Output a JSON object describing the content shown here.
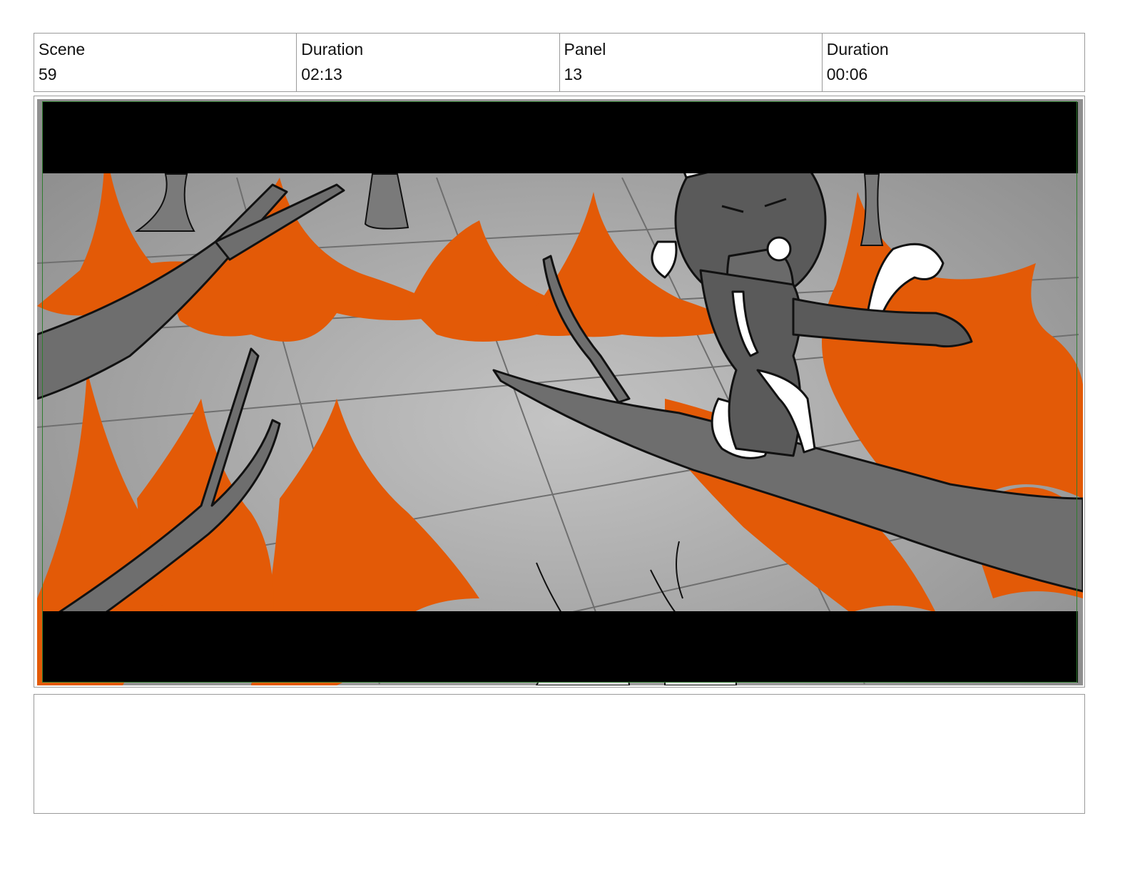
{
  "header": {
    "scene_label": "Scene",
    "scene_value": "59",
    "scene_duration_label": "Duration",
    "scene_duration_value": "02:13",
    "panel_label": "Panel",
    "panel_value": "13",
    "panel_duration_label": "Duration",
    "panel_duration_value": "00:06"
  },
  "panel_art": {
    "colors": {
      "fire": "#e35a07",
      "ground": "#a9a9a9",
      "branch": "#6e6e6e",
      "letterbox": "#000000",
      "safe_frame": "#2f7d2f"
    }
  },
  "notes": {
    "text": ""
  }
}
